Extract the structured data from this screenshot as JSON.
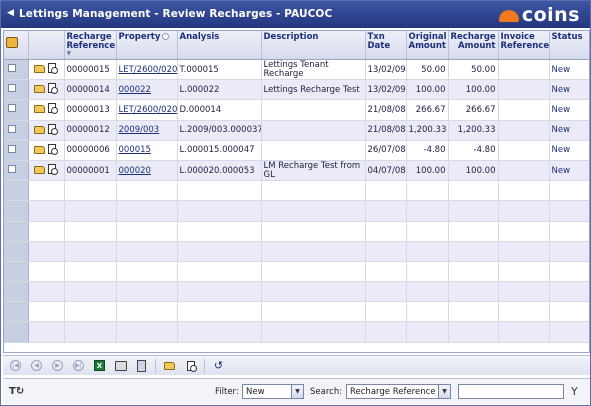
{
  "window": {
    "title": "Lettings Management - Review Recharges - PAUCOC",
    "logo_text": "coins",
    "accent": "#24367e",
    "logo_color": "#f07a1e"
  },
  "grid": {
    "headers": {
      "recharge_reference": "Recharge Reference",
      "property": "Property",
      "analysis": "Analysis",
      "description": "Description",
      "txn_date": "Txn Date",
      "original_amount": "Original Amount",
      "recharge_amount": "Recharge Amount",
      "invoice_reference": "Invoice Reference",
      "status": "Status"
    },
    "rows": [
      {
        "ref": "00000015",
        "property": "LET/2600/020",
        "analysis": "T.000015",
        "description": "Lettings Tenant Recharge",
        "txn_date": "13/02/09",
        "original": "50.00",
        "recharge": "50.00",
        "invoice": "",
        "status": "New"
      },
      {
        "ref": "00000014",
        "property": "000022",
        "analysis": "L.000022",
        "description": "Lettings Recharge Test",
        "txn_date": "13/02/09",
        "original": "100.00",
        "recharge": "100.00",
        "invoice": "",
        "status": "New"
      },
      {
        "ref": "00000013",
        "property": "LET/2600/020",
        "analysis": "D.000014",
        "description": "",
        "txn_date": "21/08/08",
        "original": "266.67",
        "recharge": "266.67",
        "invoice": "",
        "status": "New"
      },
      {
        "ref": "00000012",
        "property": "2009/003",
        "analysis": "L.2009/003.000037",
        "description": "",
        "txn_date": "21/08/08",
        "original": "1,200.33",
        "recharge": "1,200.33",
        "invoice": "",
        "status": "New"
      },
      {
        "ref": "00000006",
        "property": "000015",
        "analysis": "L.000015.000047",
        "description": "",
        "txn_date": "26/07/08",
        "original": "-4.80",
        "recharge": "-4.80",
        "invoice": "",
        "status": "New"
      },
      {
        "ref": "00000001",
        "property": "000020",
        "analysis": "L.000020.000053",
        "description": "LM Recharge Test from GL",
        "txn_date": "04/07/08",
        "original": "100.00",
        "recharge": "100.00",
        "invoice": "",
        "status": "New"
      }
    ]
  },
  "toolbar": {
    "icons": [
      "first-page-icon",
      "previous-page-icon",
      "next-page-icon",
      "last-page-icon",
      "excel-export-icon",
      "print-icon",
      "calculator-icon",
      "open-folder-icon",
      "view-document-icon",
      "undo-icon"
    ]
  },
  "filterbar": {
    "filter_label": "Filter:",
    "filter_value": "New",
    "search_label": "Search:",
    "search_field": "Recharge Reference",
    "search_value": ""
  }
}
